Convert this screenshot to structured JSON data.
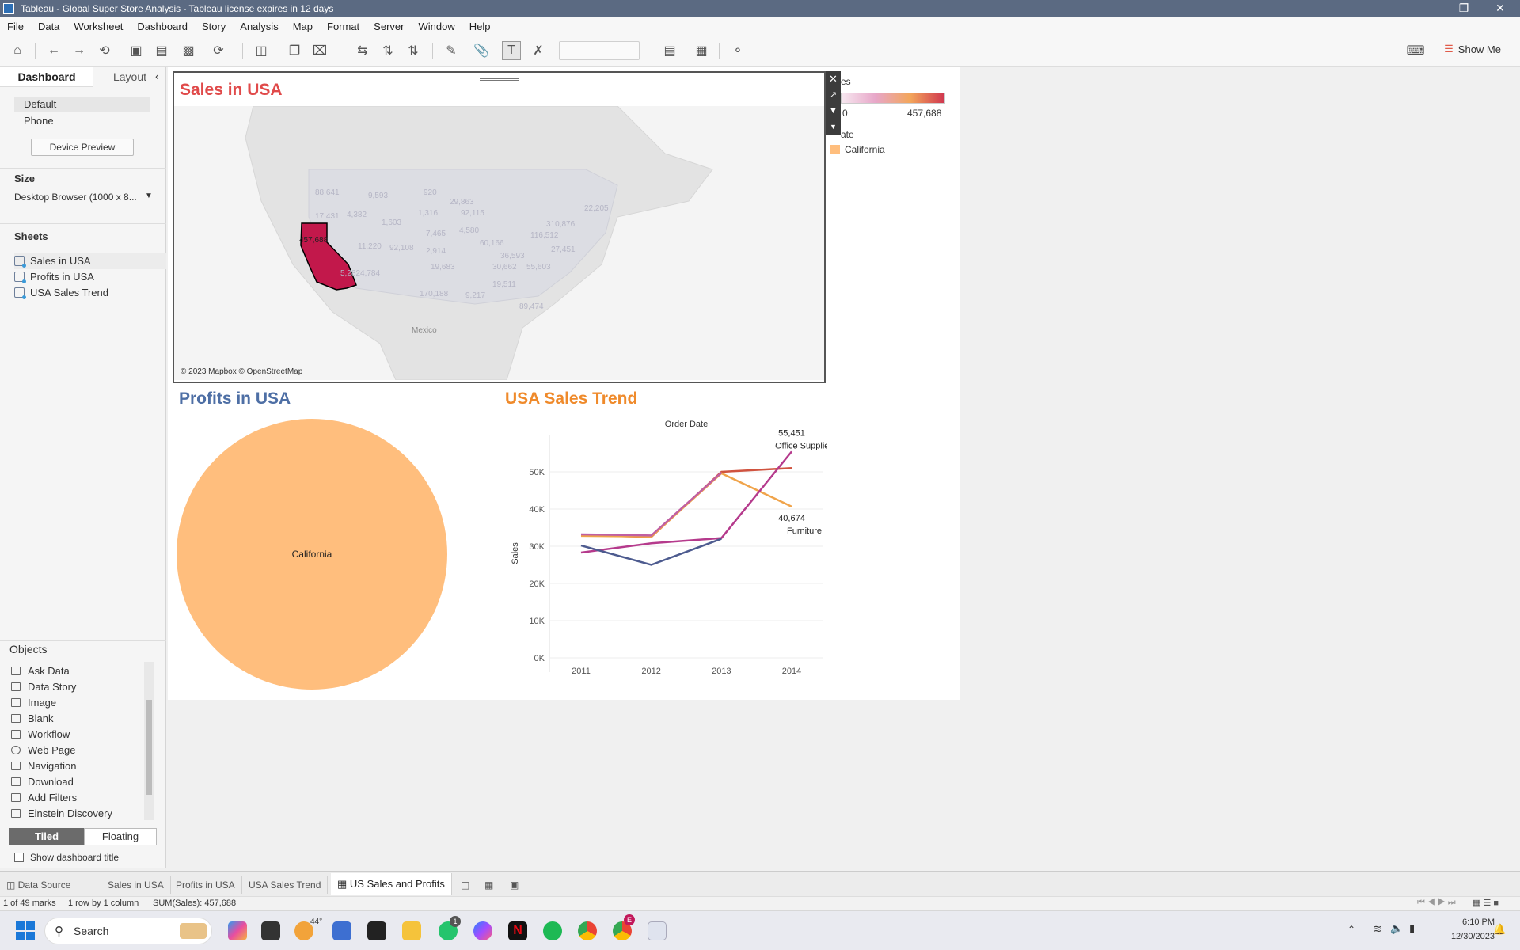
{
  "window": {
    "title": "Tableau - Global Super Store Analysis - Tableau license expires in 12 days"
  },
  "menu": [
    "File",
    "Data",
    "Worksheet",
    "Dashboard",
    "Story",
    "Analysis",
    "Map",
    "Format",
    "Server",
    "Window",
    "Help"
  ],
  "toolbar": {
    "show_me": "Show Me"
  },
  "left_pane": {
    "tab_dashboard": "Dashboard",
    "tab_layout": "Layout",
    "device_default": "Default",
    "device_phone": "Phone",
    "device_preview": "Device Preview",
    "size_heading": "Size",
    "size_value": "Desktop Browser (1000 x 8...",
    "sheets_heading": "Sheets",
    "sheets": [
      "Sales in USA",
      "Profits in USA",
      "USA Sales Trend"
    ],
    "objects_heading": "Objects",
    "objects": [
      "Ask Data",
      "Data Story",
      "Image",
      "Blank",
      "Workflow",
      "Web Page",
      "Navigation",
      "Download",
      "Add Filters",
      "Einstein Discovery"
    ],
    "tiled": "Tiled",
    "floating": "Floating",
    "show_title": "Show dashboard title"
  },
  "map": {
    "title": "Sales in USA",
    "highlight_state_value": "457,688",
    "attribution": "© 2023 Mapbox © OpenStreetMap",
    "mexico_label": "Mexico",
    "faded_labels": [
      "88,641",
      "9,593",
      "920",
      "29,863",
      "17,431",
      "4,382",
      "1,603",
      "1,316",
      "92,115",
      "310,876",
      "22,205",
      "11,220",
      "92,108",
      "7,465",
      "4,580",
      "116,512",
      "2,914",
      "60,166",
      "27,451",
      "36,593",
      "19,683",
      "30,662",
      "55,603",
      "5,2824,784",
      "19,511",
      "170,188",
      "9,217",
      "89,474"
    ]
  },
  "legend": {
    "title_partial": "es",
    "min": "0",
    "max": "457,688",
    "color_legend_partial": "ate",
    "item": "California",
    "item_color": "#ffbe7d"
  },
  "pie": {
    "title": "Profits in USA",
    "label": "California",
    "color": "#ffbe7d"
  },
  "trend": {
    "title": "USA Sales Trend"
  },
  "chart_data": {
    "type": "line",
    "title": "USA Sales Trend",
    "xlabel": "Order Date",
    "ylabel": "Sales",
    "categories": [
      "2011",
      "2012",
      "2013",
      "2014"
    ],
    "ylim": [
      0,
      60000
    ],
    "yticks": [
      "0K",
      "10K",
      "20K",
      "30K",
      "40K",
      "50K"
    ],
    "ytick_values": [
      0,
      10000,
      20000,
      30000,
      40000,
      50000
    ],
    "series": [
      {
        "color": "#d0533f",
        "values": [
          33000,
          32500,
          50000,
          51000
        ]
      },
      {
        "color": "#f0a44b",
        "values": [
          32800,
          32600,
          49600,
          40674
        ],
        "label_value": "40,674",
        "label_name": "Furniture"
      },
      {
        "color": "#b53a8c",
        "values": [
          28300,
          30800,
          32200,
          55451
        ],
        "label_value": "55,451",
        "label_name": "Office Supplies"
      },
      {
        "color": "#4d5b8f",
        "values": [
          30200,
          25000,
          32000,
          null
        ]
      },
      {
        "color": "#c05fa3",
        "values": [
          33200,
          32900,
          49800,
          null
        ]
      }
    ]
  },
  "tabs": {
    "data_source": "Data Source",
    "items": [
      "Sales in USA",
      "Profits in USA",
      "USA Sales Trend",
      "US Sales and Profits"
    ]
  },
  "status": {
    "marks": "1 of 49 marks",
    "rows": "1 row by 1 column",
    "sum": "SUM(Sales): 457,688"
  },
  "taskbar": {
    "search": "Search",
    "temp": "44°",
    "time": "6:10 PM",
    "date": "12/30/2023",
    "badge_whatsapp": "1",
    "badge_chrome": "E"
  }
}
